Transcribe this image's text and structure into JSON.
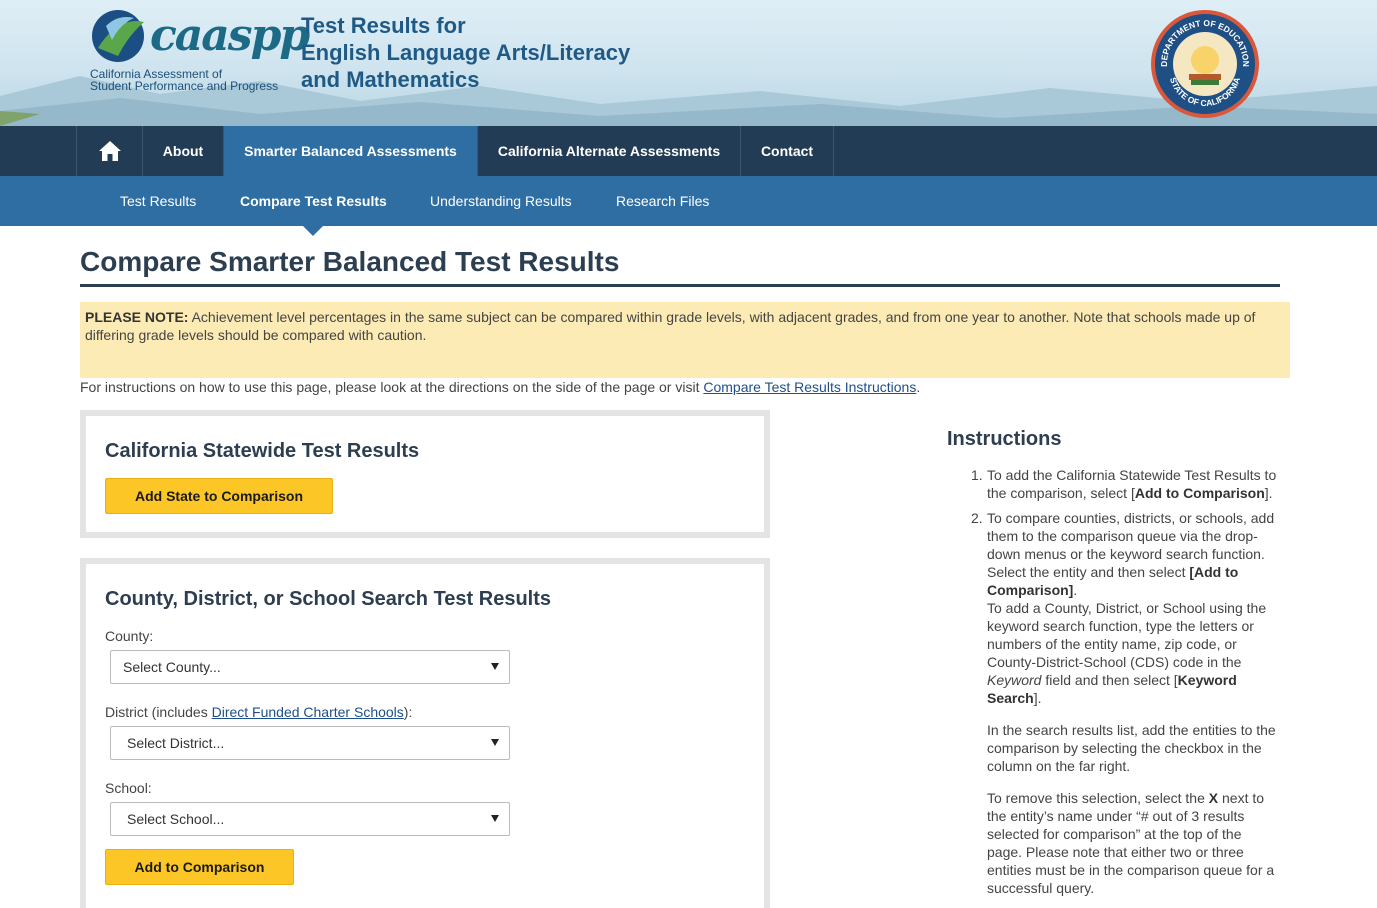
{
  "header": {
    "logo_text": "caaspp",
    "logo_subtitle_line1": "California Assessment of",
    "logo_subtitle_line2": "Student Performance and Progress",
    "title_line1": "Test Results for",
    "title_line2": "English Language Arts/Literacy",
    "title_line3": "and Mathematics",
    "seal_top_text": "DEPARTMENT OF EDUCATION",
    "seal_bottom_text": "STATE OF CALIFORNIA"
  },
  "main_nav": {
    "home_icon": "home-icon",
    "items": [
      {
        "label": "About"
      },
      {
        "label": "Smarter Balanced Assessments",
        "active": true
      },
      {
        "label": "California Alternate Assessments"
      },
      {
        "label": "Contact"
      }
    ]
  },
  "sub_nav": {
    "items": [
      {
        "label": "Test Results"
      },
      {
        "label": "Compare Test Results",
        "active": true
      },
      {
        "label": "Understanding Results"
      },
      {
        "label": "Research Files"
      }
    ]
  },
  "page": {
    "title": "Compare Smarter Balanced Test Results",
    "note_label": "PLEASE NOTE:",
    "note_text": " Achievement level percentages in the same subject can be compared within grade levels, with adjacent grades, and from one year to another. Note that schools made up of differing grade levels should be compared with caution.",
    "instructions_prefix": "For instructions on how to use this page, please look at the directions on the side of the page or visit ",
    "instructions_link": "Compare Test Results Instructions",
    "instructions_suffix": "."
  },
  "statewide_panel": {
    "title": "California Statewide Test Results",
    "button": "Add State to Comparison"
  },
  "search_panel": {
    "title": "County, District, or School Search Test Results",
    "county_label": "County:",
    "county_value": "Select County...",
    "district_label_prefix": "District (includes ",
    "district_label_link": "Direct Funded Charter Schools",
    "district_label_suffix": "):",
    "district_value": "Select District...",
    "school_label": "School:",
    "school_value": "Select School...",
    "button": "Add to Comparison"
  },
  "instructions": {
    "title": "Instructions",
    "item1_num": "1.",
    "item1_a": "To add the California Statewide Test Results to the comparison, select [",
    "item1_b": "Add to Comparison",
    "item1_c": "].",
    "item2_num": "2.",
    "item2_a": "To compare counties, districts, or schools, add them to the comparison queue via the drop-down menus or the keyword search function. Select the entity and then select ",
    "item2_b": "[Add to Comparison]",
    "item2_c": ".",
    "item2_d": "To add a County, District, or School using the keyword search function, type the letters or numbers of the entity name, zip code, or County-District-School (CDS) code in the ",
    "item2_e": "Keyword",
    "item2_f": " field and then select [",
    "item2_g": "Keyword Search",
    "item2_h": "].",
    "item2_p2": "In the search results list, add the entities to the comparison by selecting the checkbox in the column on the far right.",
    "item2_p3a": "To remove this selection, select the ",
    "item2_p3b": "X",
    "item2_p3c": " next to the entity’s name under “# out of 3 results selected for comparison” at the top of the page. Please note that either two or three entities must be in the comparison queue for a successful query."
  },
  "colors": {
    "nav_dark": "#233c55",
    "nav_blue": "#2f6ea3",
    "button_yellow": "#fcc626",
    "note_bg": "#fdebb5"
  }
}
